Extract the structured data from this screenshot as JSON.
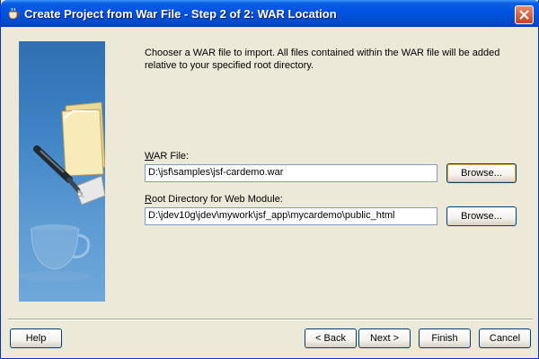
{
  "window": {
    "title": "Create Project from War File - Step 2 of 2: WAR Location",
    "close_icon": "close-icon"
  },
  "intro": {
    "text": "Chooser a WAR file to import.  All files contained within the WAR file will be added relative to your specified root directory."
  },
  "war_file": {
    "label_first": "W",
    "label_rest": "AR File:",
    "value": "D:\\jsf\\samples\\jsf-cardemo.war",
    "browse_label": "Browse..."
  },
  "root_dir": {
    "label_first": "R",
    "label_rest": "oot Directory for Web Module:",
    "value": "D:\\jdev10g\\jdev\\mywork\\jsf_app\\mycardemo\\public_html",
    "browse_label": "Browse..."
  },
  "footer": {
    "help": "Help",
    "back": "< Back",
    "next": "Next >",
    "finish": "Finish",
    "cancel": "Cancel"
  },
  "colors": {
    "titlebar": "#0054E3",
    "dialog_bg": "#ECE9D8",
    "banner": "#3F84C6"
  }
}
